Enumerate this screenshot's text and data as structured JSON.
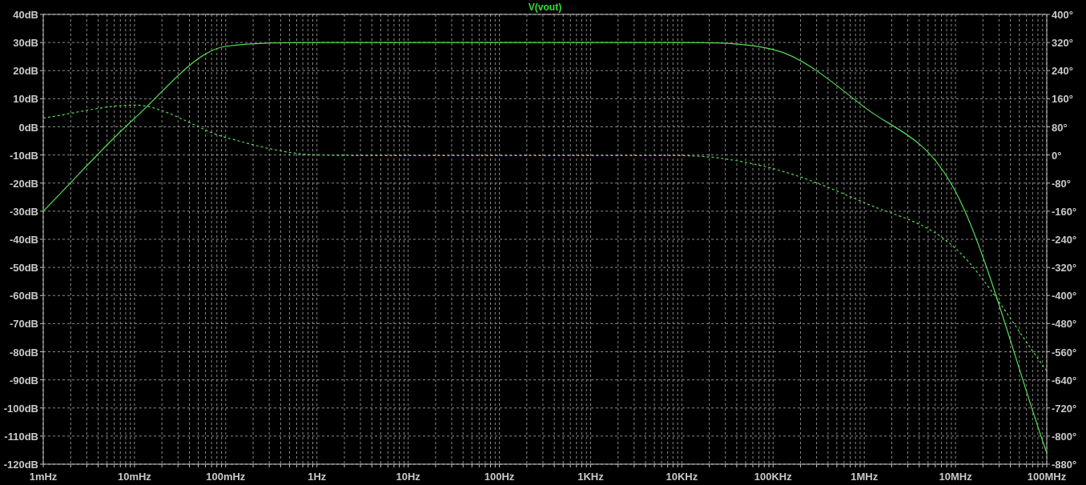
{
  "plot": {
    "chart_data": {
      "type": "line",
      "title": "V(vout)",
      "categories": [
        "1mHz",
        "10mHz",
        "100mHz",
        "1Hz",
        "10Hz",
        "100Hz",
        "1KHz",
        "10KHz",
        "100KHz",
        "1MHz",
        "10MHz",
        "100MHz"
      ],
      "grid": true,
      "ylim": [
        -120,
        40
      ],
      "yticks": [
        {
          "value": 40,
          "label": "40dB"
        },
        {
          "value": 30,
          "label": "30dB"
        },
        {
          "value": 20,
          "label": "20dB"
        },
        {
          "value": 10,
          "label": "10dB"
        },
        {
          "value": 0,
          "label": "0dB"
        },
        {
          "value": -10,
          "label": "-10dB"
        },
        {
          "value": -20,
          "label": "-20dB"
        },
        {
          "value": -30,
          "label": "-30dB"
        },
        {
          "value": -40,
          "label": "-40dB"
        },
        {
          "value": -50,
          "label": "-50dB"
        },
        {
          "value": -60,
          "label": "-60dB"
        },
        {
          "value": -70,
          "label": "-70dB"
        },
        {
          "value": -80,
          "label": "-80dB"
        },
        {
          "value": -90,
          "label": "-90dB"
        },
        {
          "value": -100,
          "label": "-100dB"
        },
        {
          "value": -110,
          "label": "-110dB"
        },
        {
          "value": -120,
          "label": "-120dB"
        }
      ],
      "y2lim": [
        -880,
        400
      ],
      "y2ticks": [
        {
          "value": 400,
          "label": "400°"
        },
        {
          "value": 320,
          "label": "320°"
        },
        {
          "value": 240,
          "label": "240°"
        },
        {
          "value": 160,
          "label": "160°"
        },
        {
          "value": 80,
          "label": "80°"
        },
        {
          "value": 0,
          "label": "0°"
        },
        {
          "value": -80,
          "label": "-80°"
        },
        {
          "value": -160,
          "label": "-160°"
        },
        {
          "value": -240,
          "label": "-240°"
        },
        {
          "value": -320,
          "label": "-320°"
        },
        {
          "value": -400,
          "label": "-400°"
        },
        {
          "value": -480,
          "label": "-480°"
        },
        {
          "value": -560,
          "label": "-560°"
        },
        {
          "value": -640,
          "label": "-640°"
        },
        {
          "value": -720,
          "label": "-720°"
        },
        {
          "value": -800,
          "label": "-800°"
        },
        {
          "value": -880,
          "label": "-880°"
        }
      ],
      "series": [
        {
          "color": "#55dd55",
          "values": [
            -30,
            3,
            28.6,
            30,
            30,
            30,
            30,
            30,
            27.5,
            7,
            -23,
            -116
          ]
        },
        {
          "color": "#55dd55",
          "axis": "y2",
          "line_style": "dashed",
          "values": [
            105,
            142,
            50,
            0,
            -2,
            -2,
            -2,
            -2,
            -39,
            -136,
            -266,
            -614
          ]
        }
      ]
    }
  }
}
